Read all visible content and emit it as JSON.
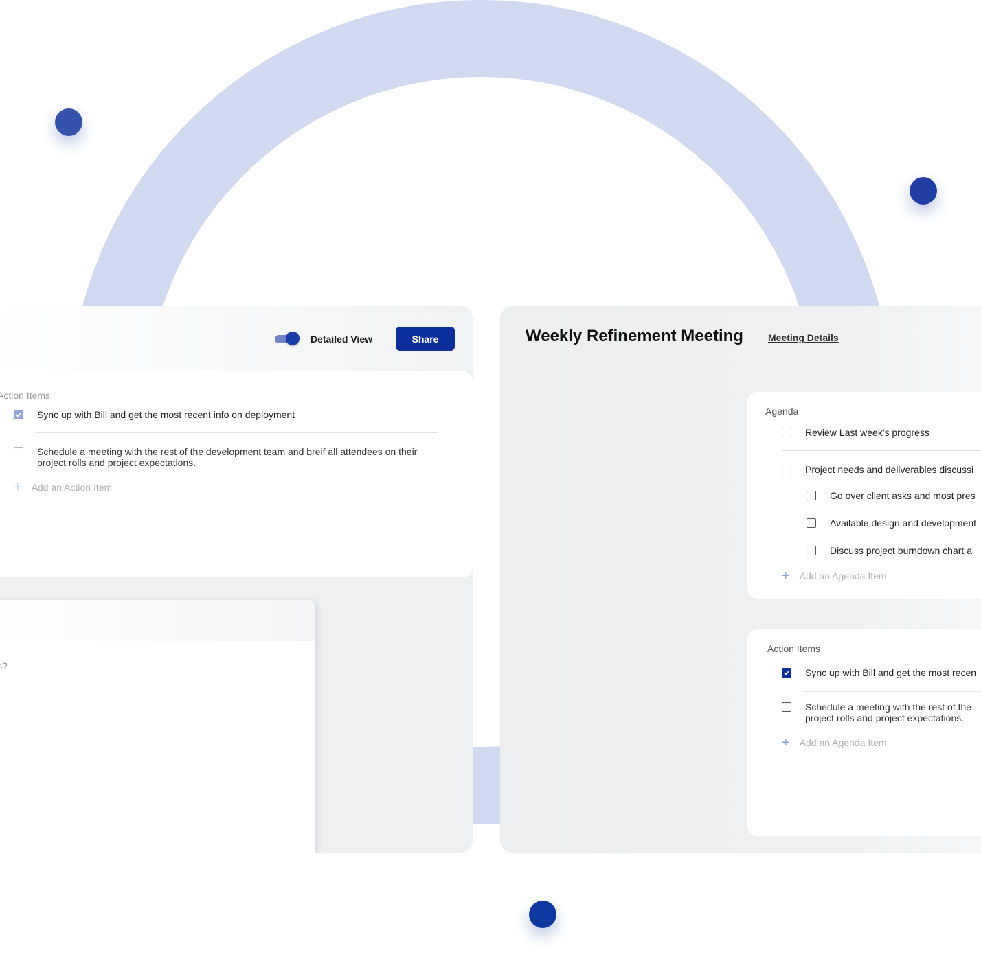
{
  "colors": {
    "accent": "#0c2f9c",
    "arc": "#d0d9ef",
    "panel": "#eff0f2"
  },
  "left_panel": {
    "toggle": {
      "label": "Detailed View",
      "on": true
    },
    "share_label": "Share",
    "action_items": {
      "title": "Action Items",
      "items": [
        {
          "text": "Sync up with Bill and get the most recent info on deployment",
          "checked": true
        },
        {
          "text_line1": "Schedule a meeting with the rest of the development team and breif all attendees on their",
          "text_line2": "project rolls and project expectations.",
          "checked": false
        }
      ],
      "add_label": "Add an Action Item"
    },
    "subpanel": {
      "text": "s?"
    }
  },
  "right_panel": {
    "title": "Weekly Refinement Meeting",
    "details_link": "Meeting Details",
    "agenda": {
      "title": "Agenda",
      "items": [
        {
          "text": "Review Last week's progress"
        },
        {
          "text": "Project needs and deliverables discussi"
        },
        {
          "text": "Go over client asks and most pres",
          "sub": true
        },
        {
          "text": "Available design and development",
          "sub": true
        },
        {
          "text": "Discuss project burndown chart a",
          "sub": true
        }
      ],
      "add_label": "Add an Agenda Item"
    },
    "action_items": {
      "title": "Action Items",
      "items": [
        {
          "text": "Sync up with Bill and get the most recen",
          "checked": true
        },
        {
          "text_line1": "Schedule a meeting with the rest of the",
          "text_line2": "project rolls and project expectations.",
          "checked": false
        }
      ],
      "add_label": "Add an Agenda Item"
    }
  }
}
